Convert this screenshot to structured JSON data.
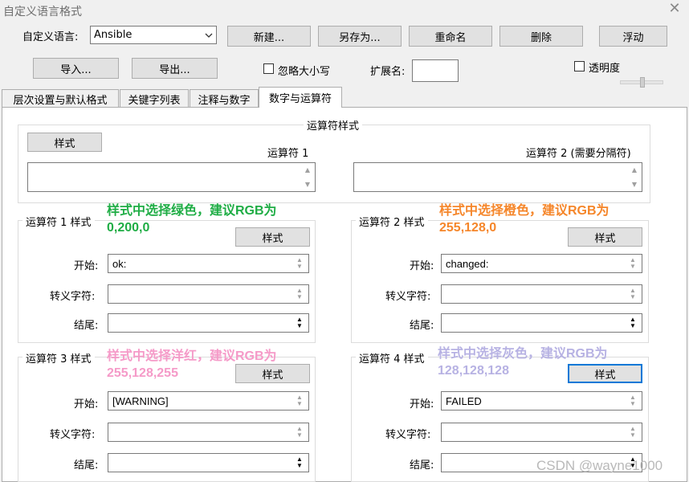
{
  "window": {
    "title": "自定义语言格式"
  },
  "language": {
    "label": "自定义语言:",
    "selected": "Ansible"
  },
  "toolbar": {
    "new": "新建...",
    "save_as": "另存为...",
    "rename": "重命名",
    "delete": "删除",
    "float": "浮动",
    "import": "导入...",
    "export": "导出...",
    "ignore_case": "忽略大小写",
    "ext_label": "扩展名:",
    "ext_value": "",
    "transparency": "透明度"
  },
  "tabs": [
    {
      "label": "层次设置与默认格式",
      "active": false
    },
    {
      "label": "关键字列表",
      "active": false
    },
    {
      "label": "注释与数字",
      "active": false
    },
    {
      "label": "数字与运算符",
      "active": true
    }
  ],
  "operator_style": {
    "title": "运算符样式",
    "style_button": "样式",
    "op1_label": "运算符 1",
    "op2_label": "运算符 2 (需要分隔符)"
  },
  "groups": [
    {
      "title": "运算符 1 样式",
      "style_button": "样式",
      "start_label": "开始:",
      "start": "ok:",
      "escape_label": "转义字符:",
      "escape": "",
      "end_label": "结尾:",
      "end": "",
      "annotation": [
        "样式中选择绿色，建议RGB为",
        "0,200,0"
      ],
      "annotation_color": "#1fad45"
    },
    {
      "title": "运算符 2 样式",
      "style_button": "样式",
      "start_label": "开始:",
      "start": "changed:",
      "escape_label": "转义字符:",
      "escape": "",
      "end_label": "结尾:",
      "end": "",
      "annotation": [
        "样式中选择橙色，建议RGB为",
        "255,128,0"
      ],
      "annotation_color": "#f5862a"
    },
    {
      "title": "运算符 3 样式",
      "style_button": "样式",
      "start_label": "开始:",
      "start": "[WARNING]",
      "escape_label": "转义字符:",
      "escape": "",
      "end_label": "结尾:",
      "end": "",
      "annotation": [
        "样式中选择洋红，建议RGB为",
        "255,128,255"
      ],
      "annotation_color": "#f59ac8"
    },
    {
      "title": "运算符 4 样式",
      "style_button": "样式",
      "start_label": "开始:",
      "start": "FAILED",
      "escape_label": "转义字符:",
      "escape": "",
      "end_label": "结尾:",
      "end": "",
      "annotation": [
        "样式中选择灰色，建议RGB为",
        "128,128,128"
      ],
      "annotation_color": "#b7b2e3"
    }
  ],
  "watermark": "CSDN @wayne1000"
}
